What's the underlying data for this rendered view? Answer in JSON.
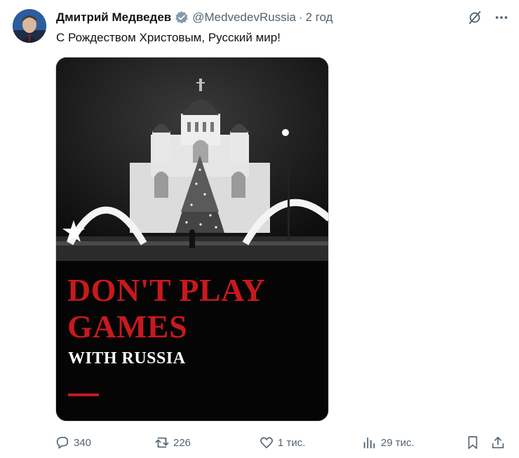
{
  "author": {
    "name": "Дмитрий Медведев",
    "handle": "@MedvedevRussia",
    "separator": "·",
    "time": "2 год"
  },
  "tweet": {
    "text": "С Рождеством Христовым, Русский мир!"
  },
  "media": {
    "headline": "DON'T PLAY GAMES",
    "subheadline": "WITH RUSSIA",
    "accent_color": "#c8191d"
  },
  "actions": {
    "replies": "340",
    "reposts": "226",
    "likes": "1 тис.",
    "views": "29 тис."
  },
  "icons": {
    "top": [
      "grok-icon",
      "more-icon"
    ],
    "bar": [
      "reply-icon",
      "repost-icon",
      "like-icon",
      "views-icon",
      "bookmark-icon",
      "share-icon"
    ]
  },
  "colors": {
    "text_primary": "#0f1419",
    "text_secondary": "#536471",
    "verified_badge": "#829aab"
  }
}
